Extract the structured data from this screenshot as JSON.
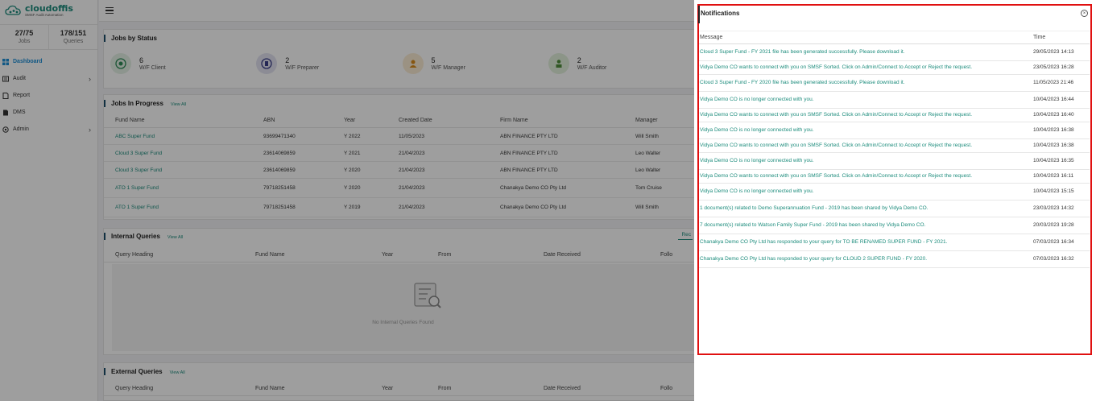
{
  "sidebar": {
    "brand": "cloudoffis",
    "brand_sub": "SMSF Audit Automation",
    "stats": [
      {
        "value": "27/75",
        "label": "Jobs"
      },
      {
        "value": "178/151",
        "label": "Queries"
      }
    ],
    "nav": [
      {
        "label": "Dashboard",
        "icon": "dashboard-icon",
        "active": true
      },
      {
        "label": "Audit",
        "icon": "audit-icon",
        "chevron": true
      },
      {
        "label": "Report",
        "icon": "report-icon"
      },
      {
        "label": "DMS",
        "icon": "dms-icon"
      },
      {
        "label": "Admin",
        "icon": "admin-icon",
        "chevron": true
      }
    ]
  },
  "jobs_by_status": {
    "title": "Jobs by Status",
    "items": [
      {
        "count": "6",
        "label": "W/F Client",
        "color": "#7fbf8a"
      },
      {
        "count": "2",
        "label": "W/F Preparer",
        "color": "#6b6fa8"
      },
      {
        "count": "5",
        "label": "W/F Manager",
        "color": "#e0a648"
      },
      {
        "count": "2",
        "label": "W/F Auditor",
        "color": "#8fbf7a"
      }
    ]
  },
  "jobs_in_progress": {
    "title": "Jobs In Progress",
    "view_all": "View All",
    "columns": [
      "Fund Name",
      "ABN",
      "Year",
      "Created Date",
      "Firm Name",
      "Manager"
    ],
    "rows": [
      [
        "ABC Super Fund",
        "93699471340",
        "Y 2022",
        "11/05/2023",
        "ABN FINANCE PTY LTD",
        "Will Smith"
      ],
      [
        "Cloud 3 Super Fund",
        "23614069859",
        "Y 2021",
        "21/04/2023",
        "ABN FINANCE PTY LTD",
        "Leo Walter"
      ],
      [
        "Cloud 3 Super Fund",
        "23614069859",
        "Y 2020",
        "21/04/2023",
        "ABN FINANCE PTY LTD",
        "Leo Walter"
      ],
      [
        "ATO 1 Super Fund",
        "79718251458",
        "Y 2020",
        "21/04/2023",
        "Chanakya Demo CO Pty Ltd",
        "Tom Cruise"
      ],
      [
        "ATO 1 Super Fund",
        "79718251458",
        "Y 2019",
        "21/04/2023",
        "Chanakya Demo CO Pty Ltd",
        "Will Smith"
      ]
    ]
  },
  "internal_queries": {
    "title": "Internal Queries",
    "view_all": "View All",
    "tab_partial": "Rec",
    "columns": [
      "Query Heading",
      "Fund Name",
      "Year",
      "From",
      "Date Received",
      "Follo"
    ],
    "empty_text": "No Internal Queries Found"
  },
  "external_queries": {
    "title": "External Queries",
    "view_all": "View All",
    "columns": [
      "Query Heading",
      "Fund Name",
      "Year",
      "From",
      "Date Received",
      "Follo"
    ]
  },
  "notifications": {
    "title": "Notifications",
    "col_message": "Message",
    "col_time": "Time",
    "items": [
      {
        "message": "Cloud 3 Super Fund - FY 2021 file has been generated successfully. Please download it.",
        "time": "29/05/2023 14:13"
      },
      {
        "message": "Vidya Demo CO wants to connect with you on SMSF Sorted. Click on Admin/Connect to Accept or Reject the request.",
        "time": "23/05/2023 16:28"
      },
      {
        "message": "Cloud 3 Super Fund - FY 2020 file has been generated successfully. Please download it.",
        "time": "11/05/2023 21:46"
      },
      {
        "message": "Vidya Demo CO is no longer connected with you.",
        "time": "10/04/2023 16:44"
      },
      {
        "message": "Vidya Demo CO wants to connect with you on SMSF Sorted. Click on Admin/Connect to Accept or Reject the request.",
        "time": "10/04/2023 16:40"
      },
      {
        "message": "Vidya Demo CO is no longer connected with you.",
        "time": "10/04/2023 16:38"
      },
      {
        "message": "Vidya Demo CO wants to connect with you on SMSF Sorted. Click on Admin/Connect to Accept or Reject the request.",
        "time": "10/04/2023 16:38"
      },
      {
        "message": "Vidya Demo CO is no longer connected with you.",
        "time": "10/04/2023 16:35"
      },
      {
        "message": "Vidya Demo CO wants to connect with you on SMSF Sorted. Click on Admin/Connect to Accept or Reject the request.",
        "time": "10/04/2023 16:11"
      },
      {
        "message": "Vidya Demo CO is no longer connected with you.",
        "time": "10/04/2023 15:15"
      },
      {
        "message": "1 document(s) related to Demo Superannuation Fund - 2019 has been shared by Vidya Demo CO.",
        "time": "23/03/2023 14:32"
      },
      {
        "message": "7 document(s) related to Watson Family Super Fund - 2019 has been shared by Vidya Demo CO.",
        "time": "20/03/2023 19:28"
      },
      {
        "message": "Chanakya Demo CO Pty Ltd has responded to your query for TO BE RENAMED SUPER FUND - FY 2021.",
        "time": "07/03/2023 16:34"
      },
      {
        "message": "Chanakya Demo CO Pty Ltd has responded to your query for CLOUD 2 SUPER FUND - FY 2020.",
        "time": "07/03/2023 16:32"
      }
    ]
  }
}
